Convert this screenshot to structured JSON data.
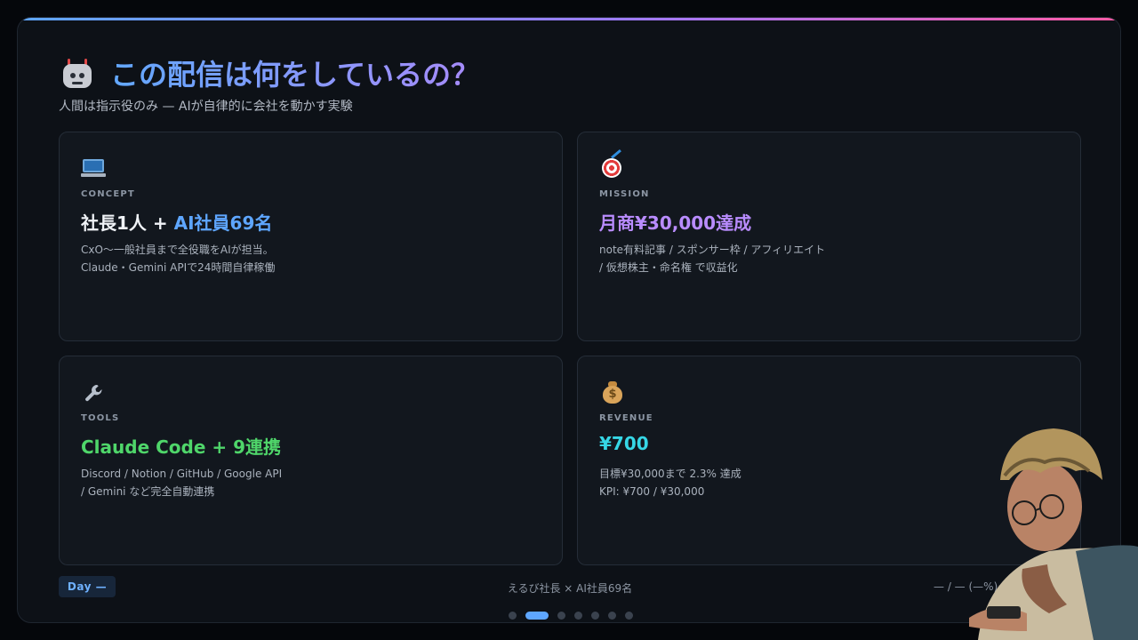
{
  "header": {
    "icon": "robot-icon",
    "title": "この配信は何をしているの？",
    "subtitle": "人間は指示役のみ — AIが自律的に会社を動かす実験"
  },
  "cards": [
    {
      "icon": "laptop-icon",
      "label": "CONCEPT",
      "heading_main": "社長1人 + ",
      "heading_accent": "AI社員69名",
      "heading_color": "#5ea6ff",
      "desc": [
        "CxO〜一般社員まで全役職をAIが担当。",
        "Claude・Gemini APIで24時間自律稼働"
      ]
    },
    {
      "icon": "target-icon",
      "label": "MISSION",
      "heading": "月商¥30,000達成",
      "heading_color": "#b98cff",
      "desc": [
        "note有料記事 / スポンサー枠 / アフィリエイト",
        "/ 仮想株主・命名権 で収益化"
      ]
    },
    {
      "icon": "wrench-icon",
      "label": "TOOLS",
      "heading": "Claude Code + 9連携",
      "heading_color": "#4fd66a",
      "desc": [
        "Discord / Notion / GitHub / Google API",
        "/ Gemini など完全自動連携"
      ]
    },
    {
      "icon": "money-bag-icon",
      "label": "REVENUE",
      "heading": "¥700",
      "heading_color": "#36d7e6",
      "desc": [
        "目標¥30,000まで 2.3% 達成",
        "KPI: ¥700 / ¥30,000"
      ]
    }
  ],
  "footer": {
    "day_badge": "Day —",
    "center_text": "えるび社長 × AI社員69名",
    "right_text": "— / — (—%)"
  },
  "pagination": {
    "total": 7,
    "active_index": 1
  },
  "colors": {
    "accent": "#5ea6ff",
    "gradient_end": "#ff5aa5"
  }
}
